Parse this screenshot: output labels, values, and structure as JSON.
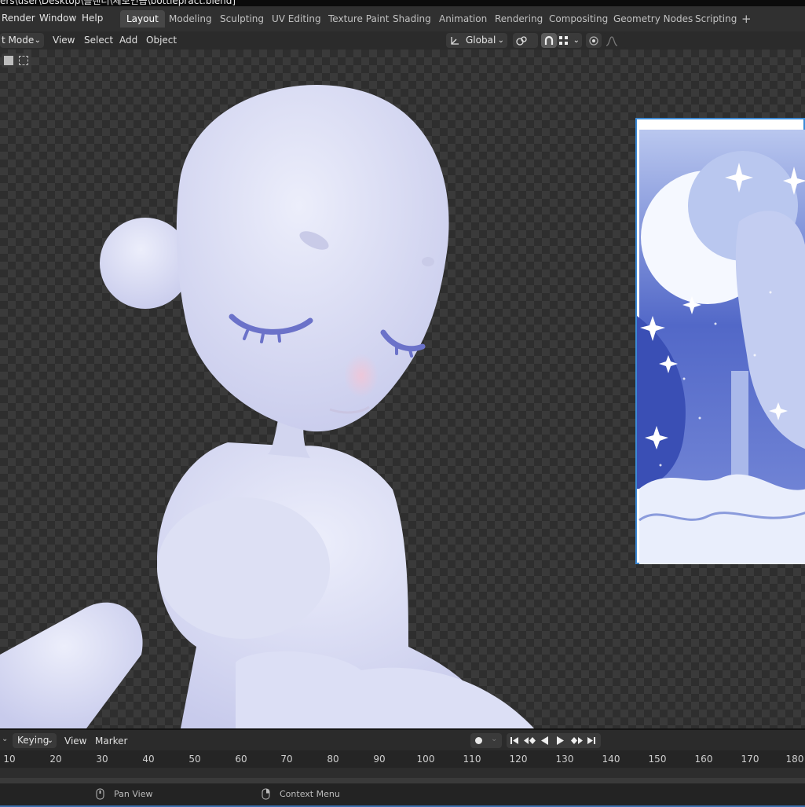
{
  "window": {
    "title_path": "ers\\user\\Desktop\\블렌더\\체보연습\\bottlepract.blend]"
  },
  "menus": [
    "Render",
    "Window",
    "Help"
  ],
  "workspaces": {
    "tabs": [
      "Layout",
      "Modeling",
      "Sculpting",
      "UV Editing",
      "Texture Paint",
      "Shading",
      "Animation",
      "Rendering",
      "Compositing",
      "Geometry Nodes",
      "Scripting"
    ],
    "active": "Layout",
    "add_label": "+"
  },
  "viewport_header": {
    "mode": "t Mode",
    "menus": [
      "View",
      "Select",
      "Add",
      "Object"
    ],
    "transform_orientation": "Global"
  },
  "timeline": {
    "menus": [
      "Keying",
      "View",
      "Marker"
    ],
    "frames": [
      "10",
      "20",
      "30",
      "40",
      "50",
      "60",
      "70",
      "80",
      "90",
      "100",
      "110",
      "120",
      "130",
      "140",
      "150",
      "160",
      "170",
      "180"
    ]
  },
  "statusbar": {
    "pan": "Pan View",
    "context": "Context Menu"
  },
  "colors": {
    "accent": "#3c6fb0",
    "active_tab": "#474747",
    "figure": "#dfe2f6",
    "lashes": "#6b72c9"
  },
  "icons": {
    "transform": "axis-icon",
    "pivot": "link-icon",
    "snap": "magnet-icon",
    "snap_grid": "grid-icon",
    "proportional": "circle-icon",
    "falloff": "curve-icon",
    "playback": [
      "jump-start-icon",
      "prev-keyframe-icon",
      "reverse-play-icon",
      "play-icon",
      "next-keyframe-icon",
      "jump-end-icon"
    ]
  }
}
